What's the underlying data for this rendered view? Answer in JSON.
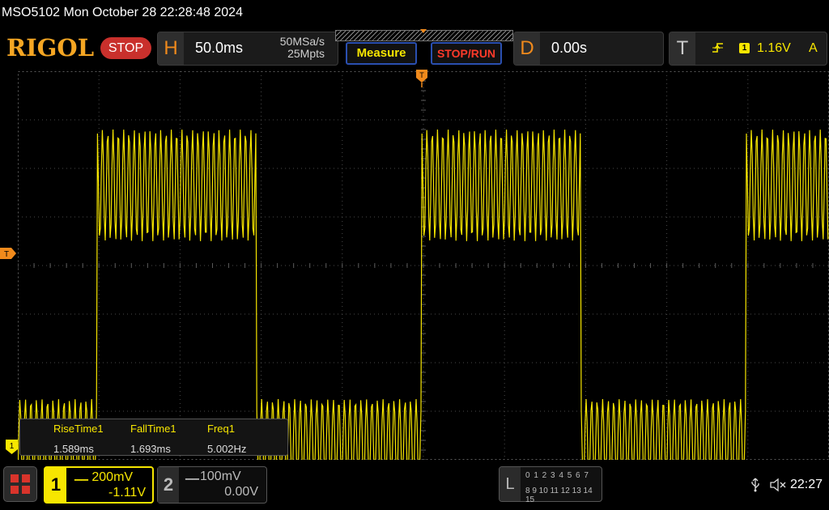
{
  "title_bar": {
    "text": "MSO5102  Mon October 28 22:28:48 2024"
  },
  "top_bar": {
    "logo": "RIGOL",
    "run_state": "STOP",
    "horizontal": {
      "letter": "H",
      "timebase": "50.0ms",
      "sample_rate": "50MSa/s",
      "memory_depth": "25Mpts"
    },
    "measure_button": "Measure",
    "stop_run_button": "STOP/RUN",
    "delay": {
      "letter": "D",
      "value": "0.00s"
    },
    "trigger": {
      "letter": "T",
      "edge_icon": "rising-edge-icon",
      "source": "1",
      "level": "1.16V",
      "mode": "A"
    }
  },
  "markers": {
    "trigger_top": "T",
    "trigger_left": "T",
    "ch1": "1"
  },
  "measurements": [
    {
      "label": "RiseTime1",
      "value": "1.589ms"
    },
    {
      "label": "FallTime1",
      "value": "1.693ms"
    },
    {
      "label": "Freq1",
      "value": "5.002Hz"
    }
  ],
  "channels": {
    "ch1": {
      "number": "1",
      "scale": "200mV",
      "offset": "-1.11V",
      "color": "#f7e600"
    },
    "ch2": {
      "number": "2",
      "scale": "100mV",
      "offset": "0.00V",
      "color": "#bbbbbb"
    }
  },
  "logic_panel": {
    "letter": "L",
    "row1": "0 1 2 3  4 5 6 7",
    "row2": "8 9 10 11 12 13 14 15"
  },
  "status": {
    "usb_icon": "usb-icon",
    "speaker_icon": "speaker-muted-icon",
    "time": "22:27"
  },
  "waveform": {
    "description_color": "#f7e600",
    "period_ms": 200,
    "timebase_ms_per_div": 50,
    "duty_high_fraction": 0.49,
    "high_band_v": [
      0.1,
      0.56
    ],
    "low_band_v": [
      -0.55,
      -0.9
    ],
    "carrier_cycles_per_high": 30,
    "carrier_cycles_per_low": 30
  },
  "accent_colors": {
    "orange": "#f08a1c",
    "red": "#c9302c",
    "yellow": "#f7e600",
    "blue_border": "#2a4fb0"
  }
}
